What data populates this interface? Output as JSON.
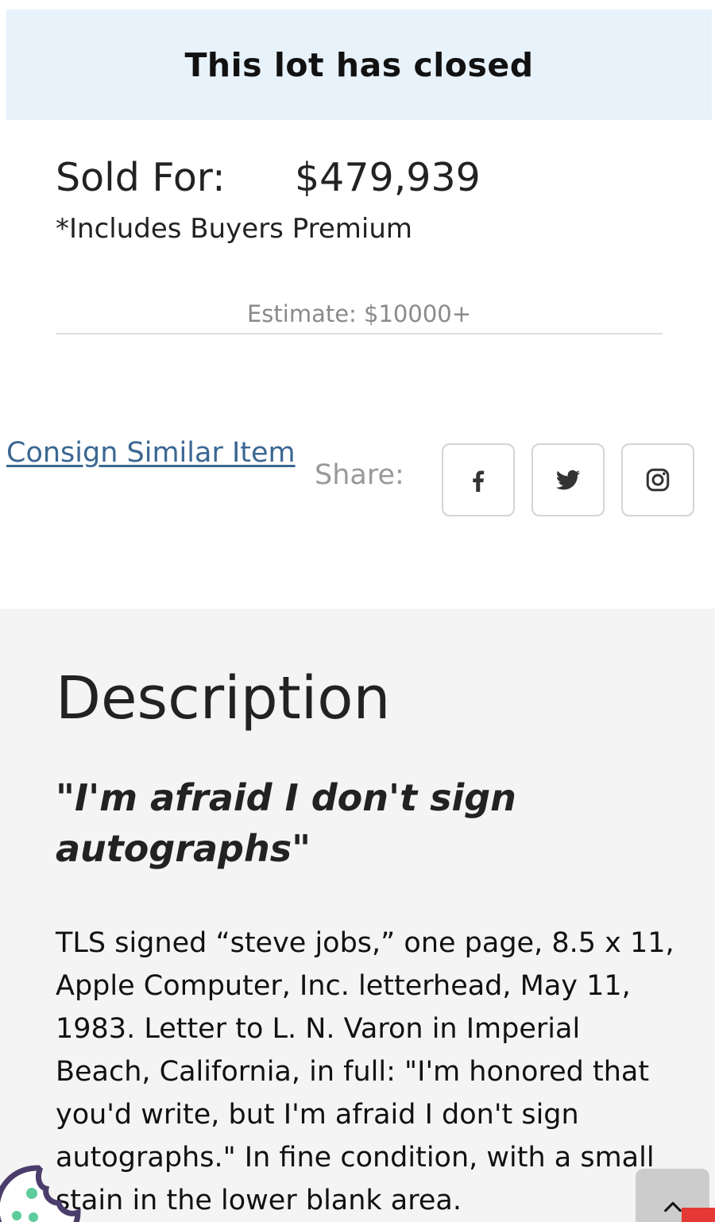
{
  "banner": {
    "title": "This lot has closed"
  },
  "sale": {
    "sold_label": "Sold For:",
    "price": "$479,939",
    "premium_note": "*Includes Buyers Premium",
    "estimate": "Estimate: $10000+"
  },
  "actions": {
    "consign_link": "Consign Similar Item",
    "share_label": "Share:",
    "share_icons": [
      "facebook-icon",
      "twitter-icon",
      "instagram-icon"
    ]
  },
  "description": {
    "heading": "Description",
    "quote": "\"I'm afraid I don't sign autographs\"",
    "body": "TLS signed “steve jobs,” one page, 8.5 x 11, Apple Computer, Inc. letterhead, May 11, 1983. Letter to L. N. Varon in Imperial Beach, California, in full: \"I'm honored that you'd write, but I'm afraid I don't sign autographs.\" In fine condition, with a small stain in the lower blank area."
  },
  "colors": {
    "banner_bg": "#e8f2fb",
    "link": "#3b6792",
    "section_bg": "#f4f4f4",
    "cookie_purple": "#4b3d6b",
    "cookie_dots": "#5ecb9c"
  }
}
